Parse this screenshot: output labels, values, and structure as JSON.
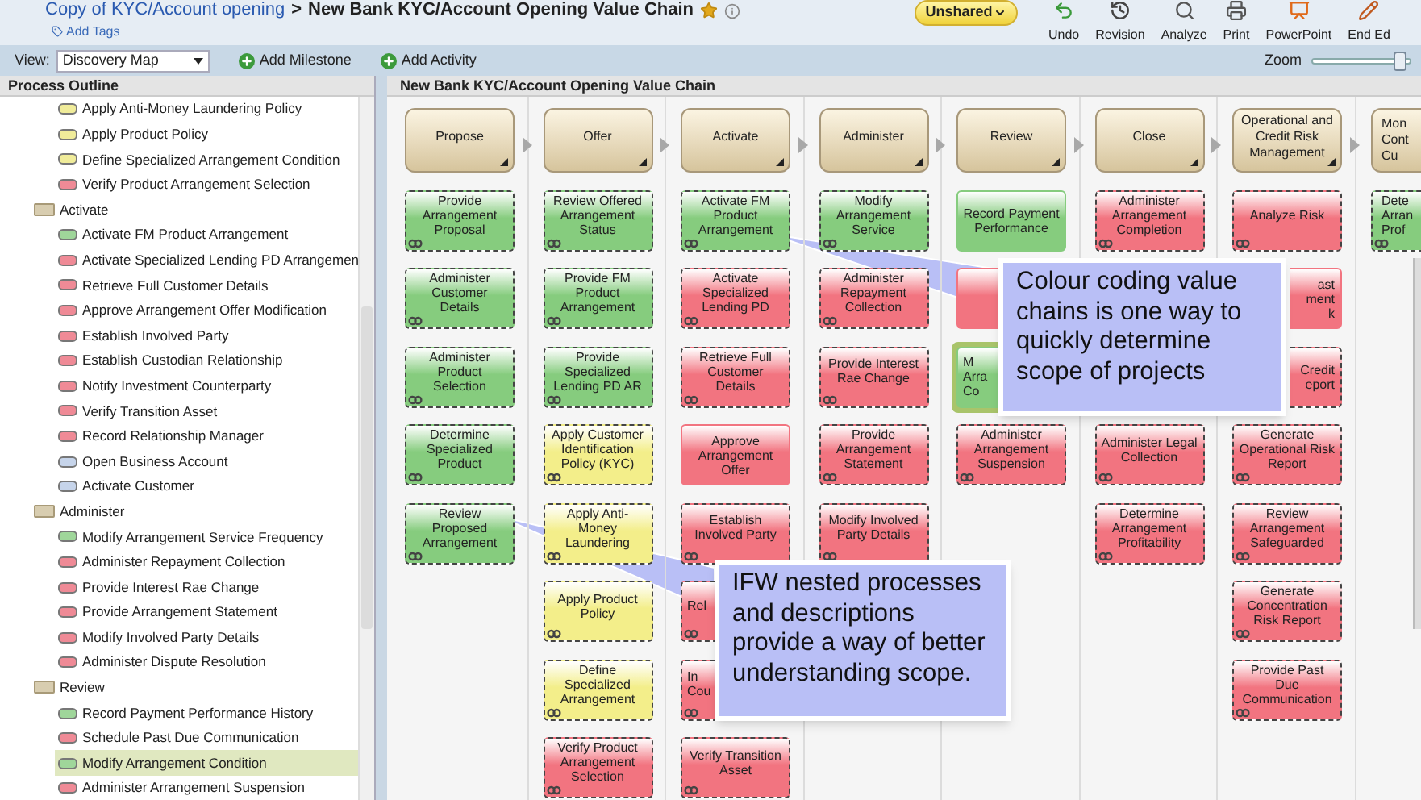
{
  "header": {
    "breadcrumb": "Copy of KYC/Account opening",
    "separator": ">",
    "title": "New Bank KYC/Account Opening Value Chain",
    "add_tags": "Add Tags",
    "share_button": "Unshared",
    "tools": [
      {
        "kind": "undo",
        "label": "Undo"
      },
      {
        "kind": "history",
        "label": "Revision"
      },
      {
        "kind": "analyze",
        "label": "Analyze"
      },
      {
        "kind": "print",
        "label": "Print"
      },
      {
        "kind": "powerpoint",
        "label": "PowerPoint"
      },
      {
        "kind": "edit",
        "label": "End Ed"
      }
    ]
  },
  "toolbar": {
    "view_label": "View:",
    "view_value": "Discovery Map",
    "actions": [
      "Add Milestone",
      "Add Activity"
    ],
    "zoom_label": "Zoom",
    "zoom": {
      "level": 0.95
    }
  },
  "outline": {
    "title": "Process Outline",
    "groups": [
      {
        "children": [
          {
            "label": "Apply Anti-Money Laundering Policy",
            "color": "#f0ec9a",
            "selected": false
          },
          {
            "label": "Apply Product Policy",
            "color": "#f0ec9a",
            "selected": false
          },
          {
            "label": "Define Specialized Arrangement Condition",
            "color": "#f0ec9a",
            "selected": false
          },
          {
            "label": "Verify Product Arrangement Selection",
            "color": "#ef8a96",
            "selected": false
          }
        ]
      },
      {
        "label": "Activate",
        "children": [
          {
            "label": "Activate FM Product Arrangement",
            "color": "#9fd69a",
            "selected": false
          },
          {
            "label": "Activate Specialized Lending PD Arrangemen",
            "color": "#ef8a96",
            "selected": false
          },
          {
            "label": "Retrieve Full Customer Details",
            "color": "#ef8a96",
            "selected": false
          },
          {
            "label": "Approve Arrangement Offer Modification",
            "color": "#ef8a96",
            "selected": false
          },
          {
            "label": "Establish Involved Party",
            "color": "#ef8a96",
            "selected": false
          },
          {
            "label": "Establish Custodian Relationship",
            "color": "#ef8a96",
            "selected": false
          },
          {
            "label": "Notify Investment Counterparty",
            "color": "#ef8a96",
            "selected": false
          },
          {
            "label": "Verify Transition Asset",
            "color": "#ef8a96",
            "selected": false
          },
          {
            "label": "Record Relationship Manager",
            "color": "#ef8a96",
            "selected": false
          },
          {
            "label": "Open Business Account",
            "color": "#c6d4ea",
            "selected": false
          },
          {
            "label": "Activate Customer",
            "color": "#c6d4ea",
            "selected": false
          }
        ]
      },
      {
        "label": "Administer",
        "children": [
          {
            "label": "Modify Arrangement Service Frequency",
            "color": "#9fd69a",
            "selected": false
          },
          {
            "label": "Administer Repayment Collection",
            "color": "#ef8a96",
            "selected": false
          },
          {
            "label": "Provide Interest Rae Change",
            "color": "#ef8a96",
            "selected": false
          },
          {
            "label": "Provide Arrangement Statement",
            "color": "#ef8a96",
            "selected": false
          },
          {
            "label": "Modify Involved Party Details",
            "color": "#ef8a96",
            "selected": false
          },
          {
            "label": "Administer Dispute Resolution",
            "color": "#ef8a96",
            "selected": false
          }
        ]
      },
      {
        "label": "Review",
        "children": [
          {
            "label": "Record Payment Performance History",
            "color": "#9fd69a",
            "selected": false
          },
          {
            "label": "Schedule Past Due Communication",
            "color": "#ef8a96",
            "selected": false
          },
          {
            "label": "Modify Arrangement Condition",
            "color": "#9fd69a",
            "selected": true
          },
          {
            "label": "Administer Arrangement Suspension",
            "color": "#ef8a96",
            "selected": false
          }
        ]
      }
    ]
  },
  "chain": {
    "title": "New Bank KYC/Account Opening Value Chain",
    "columns": [
      {
        "kind": "full",
        "stage": "Propose",
        "activities": [
          {
            "kind": "full",
            "text": "Provide Arrangement Proposal",
            "color": "#86cc7e",
            "nested": true,
            "selected": false
          },
          {
            "kind": "full",
            "text": "Administer Customer Details",
            "color": "#86cc7e",
            "nested": true,
            "selected": false
          },
          {
            "kind": "full",
            "text": "Administer Product Selection",
            "color": "#86cc7e",
            "nested": true,
            "selected": false
          },
          {
            "kind": "full",
            "text": "Determine Specialized Product",
            "color": "#86cc7e",
            "nested": true,
            "selected": false
          },
          {
            "kind": "full",
            "text": "Review Proposed Arrangement",
            "color": "#86cc7e",
            "nested": true,
            "selected": false
          }
        ]
      },
      {
        "kind": "full",
        "stage": "Offer",
        "activities": [
          {
            "kind": "full",
            "text": "Review Offered Arrangement Status",
            "color": "#86cc7e",
            "nested": true,
            "selected": false
          },
          {
            "kind": "full",
            "text": "Provide FM Product Arrangement",
            "color": "#86cc7e",
            "nested": true,
            "selected": false
          },
          {
            "kind": "full",
            "text": "Provide Specialized Lending PD AR",
            "color": "#86cc7e",
            "nested": true,
            "selected": false
          },
          {
            "kind": "full",
            "text": "Apply Customer Identification Policy (KYC)",
            "color": "#f3ee8a",
            "nested": true,
            "selected": false
          },
          {
            "kind": "full",
            "text": "Apply Anti-Money Laundering",
            "color": "#f3ee8a",
            "nested": true,
            "selected": false
          },
          {
            "kind": "full",
            "text": "Apply Product Policy",
            "color": "#f3ee8a",
            "nested": true,
            "selected": false
          },
          {
            "kind": "full",
            "text": "Define Specialized Arrangement",
            "color": "#f3ee8a",
            "nested": true,
            "selected": false
          },
          {
            "kind": "full",
            "text": "Verify Product Arrangement Selection",
            "color": "#f27480",
            "nested": true,
            "selected": false
          }
        ]
      },
      {
        "kind": "full",
        "stage": "Activate",
        "activities": [
          {
            "kind": "full",
            "text": "Activate FM Product Arrangement",
            "color": "#86cc7e",
            "nested": true,
            "selected": false
          },
          {
            "kind": "full",
            "text": "Activate Specialized Lending PD",
            "color": "#f27480",
            "nested": true,
            "selected": false
          },
          {
            "kind": "full",
            "text": "Retrieve Full Customer Details",
            "color": "#f27480",
            "nested": true,
            "selected": false
          },
          {
            "kind": "full",
            "text": "Approve Arrangement Offer",
            "color": "#f27480",
            "nested": false,
            "selected": false
          },
          {
            "kind": "full",
            "text": "Establish Involved Party",
            "color": "#f27480",
            "nested": true,
            "selected": false
          },
          {
            "kind": "left_part",
            "text": "Rel",
            "color": "#f27480",
            "nested": true,
            "selected": false
          },
          {
            "kind": "left_part",
            "text": "In Cou",
            "color": "#f27480",
            "nested": true,
            "selected": false
          },
          {
            "kind": "full",
            "text": "Verify Transition Asset",
            "color": "#f27480",
            "nested": true,
            "selected": false
          }
        ]
      },
      {
        "kind": "full",
        "stage": "Administer",
        "activities": [
          {
            "kind": "full",
            "text": "Modify Arrangement Service",
            "color": "#86cc7e",
            "nested": true,
            "selected": false
          },
          {
            "kind": "full",
            "text": "Administer Repayment Collection",
            "color": "#f27480",
            "nested": true,
            "selected": false
          },
          {
            "kind": "full",
            "text": "Provide Interest Rae Change",
            "color": "#f27480",
            "nested": true,
            "selected": false
          },
          {
            "kind": "full",
            "text": "Provide Arrangement Statement",
            "color": "#f27480",
            "nested": true,
            "selected": false
          },
          {
            "kind": "full",
            "text": "Modify Involved Party Details",
            "color": "#f27480",
            "nested": true,
            "selected": false
          }
        ]
      },
      {
        "kind": "full",
        "stage": "Review",
        "activities": [
          {
            "kind": "full",
            "text": "Record Payment Performance",
            "color": "#86cc7e",
            "nested": false,
            "selected": false
          },
          {
            "kind": "left_part",
            "color": "#f27480",
            "nested": false,
            "selected": false
          },
          {
            "kind": "left_part",
            "text": "M Arra Co",
            "color": "#86cc7e",
            "nested": false,
            "selected": true
          },
          {
            "kind": "full",
            "text": "Administer Arrangement Suspension",
            "color": "#f27480",
            "nested": true,
            "selected": false
          }
        ]
      },
      {
        "kind": "full",
        "stage": "Close",
        "activities": [
          {
            "kind": "full",
            "text": "Administer Arrangement Completion",
            "color": "#f27480",
            "nested": true,
            "selected": false
          },
          {
            "kind": "covered"
          },
          {
            "kind": "covered"
          },
          {
            "kind": "full",
            "text": "Administer Legal Collection",
            "color": "#f27480",
            "nested": true,
            "selected": false
          },
          {
            "kind": "full",
            "text": "Determine Arrangement Profitability",
            "color": "#f27480",
            "nested": true,
            "selected": false
          }
        ]
      },
      {
        "kind": "full",
        "stage": "Operational and Credit Risk Management",
        "activities": [
          {
            "kind": "full",
            "text": "Analyze Risk",
            "color": "#f27480",
            "nested": true,
            "selected": false
          },
          {
            "kind": "right_part",
            "text": "ast ment k",
            "color": "#f27480",
            "nested": false,
            "selected": false
          },
          {
            "kind": "right_part",
            "text": "Credit eport",
            "color": "#f27480",
            "nested": true,
            "selected": false
          },
          {
            "kind": "full",
            "text": "Generate Operational Risk Report",
            "color": "#f27480",
            "nested": true,
            "selected": false
          },
          {
            "kind": "full",
            "text": "Review Arrangement Safeguarded",
            "color": "#f27480",
            "nested": true,
            "selected": false
          },
          {
            "kind": "full",
            "text": "Generate Concentration Risk Report",
            "color": "#f27480",
            "nested": true,
            "selected": false
          },
          {
            "kind": "full",
            "text": "Provide Past Due Communication",
            "color": "#f27480",
            "nested": true,
            "selected": false
          }
        ]
      },
      {
        "kind": "clipped",
        "stage": "Mon Cont Cu",
        "activities": [
          {
            "kind": "clipped",
            "text": "Dete Arran Prof",
            "color": "#86cc7e",
            "nested": true,
            "selected": false
          }
        ]
      }
    ]
  },
  "callouts": [
    {
      "text": "Colour coding value chains is one way to quickly determine scope of projects"
    },
    {
      "text": "IFW nested processes and descriptions provide a way of better understanding scope."
    }
  ]
}
